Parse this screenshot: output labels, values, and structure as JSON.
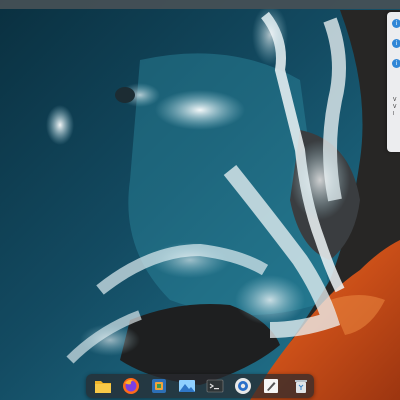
{
  "wallpaper": {
    "description_icon": "ocean-shoreline-wallpaper"
  },
  "side_window": {
    "buttons": [
      "info-icon",
      "info-icon",
      "info-icon"
    ],
    "text": [
      "V",
      "V",
      "l"
    ]
  },
  "dock": {
    "items": [
      {
        "name": "files",
        "icon": "folder-icon",
        "running": false
      },
      {
        "name": "firefox",
        "icon": "firefox-icon",
        "running": false
      },
      {
        "name": "software",
        "icon": "software-center-icon",
        "running": false
      },
      {
        "name": "image-viewer",
        "icon": "image-viewer-icon",
        "running": false
      },
      {
        "name": "terminal",
        "icon": "terminal-icon",
        "running": false
      },
      {
        "name": "settings",
        "icon": "settings-icon",
        "running": false
      },
      {
        "name": "text-editor",
        "icon": "text-editor-icon",
        "running": false
      },
      {
        "name": "trash",
        "icon": "trash-icon",
        "running": false
      }
    ]
  },
  "colors": {
    "ocean_deep": "#0d3446",
    "ocean_mid": "#1f6078",
    "foam": "#e9f1f4",
    "rock": "#2b2b2b",
    "lava": "#d2541d"
  }
}
